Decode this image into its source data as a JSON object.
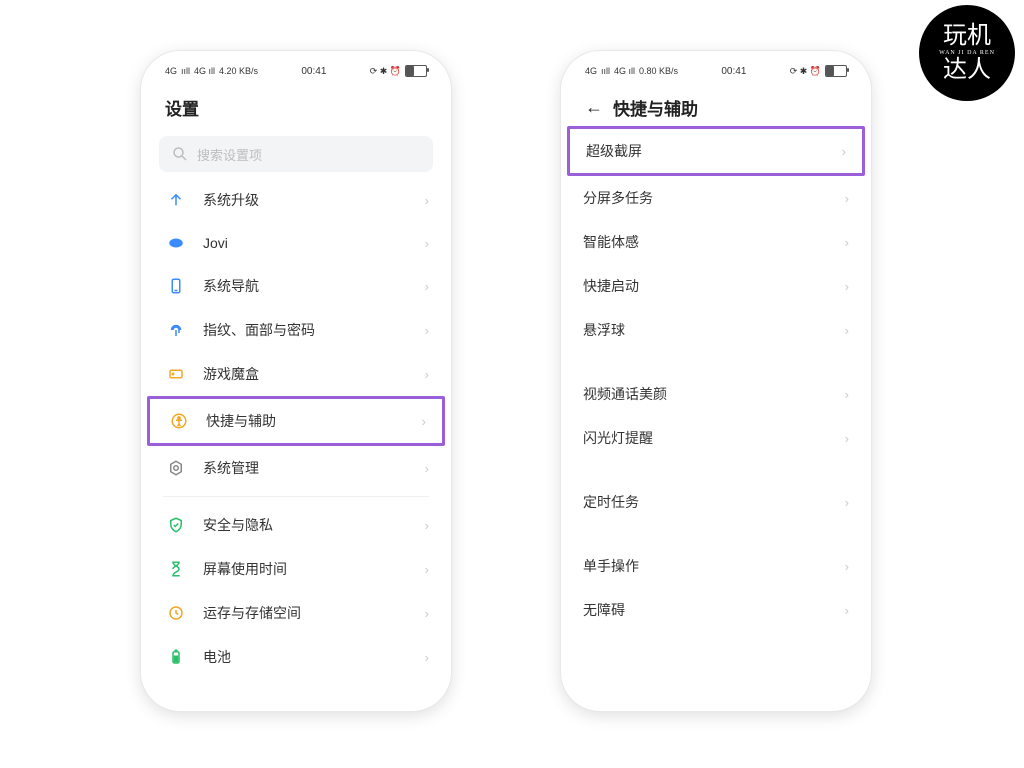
{
  "status": {
    "net_left": "4G",
    "signal": "ııll",
    "wifi": "4G ıll",
    "kbs_left": "4.20 KB/s",
    "kbs_right": "0.80 KB/s",
    "time": "00:41",
    "icons_right": "⟳ ✱ ⏰"
  },
  "phone1": {
    "title": "设置",
    "search_placeholder": "搜索设置项",
    "items": {
      "upgrade": "系统升级",
      "jovi": "Jovi",
      "nav": "系统导航",
      "fingerprint": "指纹、面部与密码",
      "gamebox": "游戏魔盒",
      "shortcut": "快捷与辅助",
      "sysmgr": "系统管理",
      "security": "安全与隐私",
      "screentime": "屏幕使用时间",
      "storage": "运存与存储空间",
      "battery": "电池"
    }
  },
  "phone2": {
    "title": "快捷与辅助",
    "items": {
      "sshot": "超级截屏",
      "split": "分屏多任务",
      "smart": "智能体感",
      "quickstart": "快捷启动",
      "floater": "悬浮球",
      "beauty": "视频通话美颜",
      "flash": "闪光灯提醒",
      "timed": "定时任务",
      "onehand": "单手操作",
      "access": "无障碍"
    }
  },
  "logo": {
    "line1": "玩机",
    "mid": "WAN JI DA REN",
    "line2": "达人"
  }
}
